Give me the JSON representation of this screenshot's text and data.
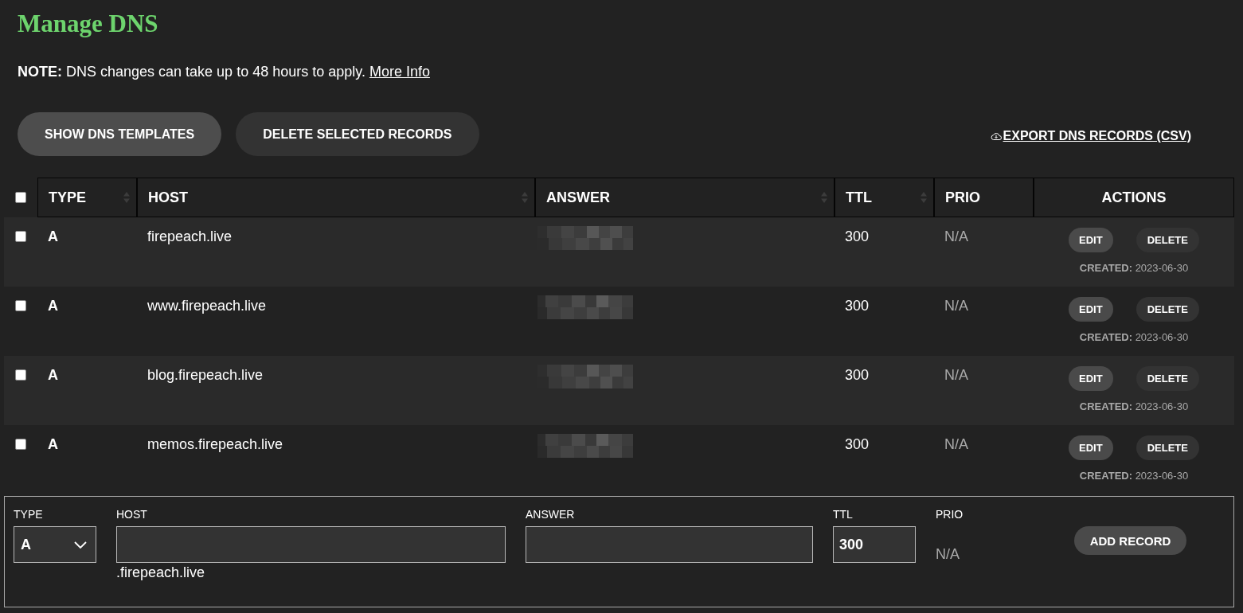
{
  "page": {
    "title": "Manage DNS"
  },
  "note": {
    "text": "**NOTE:** DNS changes can take up to 48 hours to apply.",
    "link": "More Info"
  },
  "toolbar": {
    "buttons": [
      {
        "label": "SHOW DNS TEMPLATES",
        "kind": "primary"
      },
      {
        "label": "DELETE SELECTED RECORDS",
        "kind": "secondary"
      }
    ],
    "export_link": "EXPORT DNS RECORDS (CSV)"
  },
  "table": {
    "select_all": {
      "checked": false
    },
    "columns": [
      {
        "label": "TYPE",
        "sortable": true
      },
      {
        "label": "HOST",
        "sortable": true
      },
      {
        "label": "ANSWER",
        "sortable": true
      },
      {
        "label": "TTL",
        "sortable": true
      },
      {
        "label": "PRIO",
        "sortable": false
      },
      {
        "label": "ACTIONS",
        "sortable": false
      }
    ],
    "rows": [
      {
        "checked": false,
        "type": "A",
        "host": "firepeach.live",
        "answer_redacted": true,
        "ttl": "300",
        "prio": "N/A",
        "actions": [
          {
            "label": "EDIT",
            "kind": "edit"
          },
          {
            "label": "DELETE",
            "kind": "delete"
          }
        ],
        "created": "**CREATED:** 2023-06-30"
      },
      {
        "checked": false,
        "type": "A",
        "host": "www.firepeach.live",
        "answer_redacted": true,
        "ttl": "300",
        "prio": "N/A",
        "actions": [
          {
            "label": "EDIT",
            "kind": "edit"
          },
          {
            "label": "DELETE",
            "kind": "delete"
          }
        ],
        "created": "**CREATED:** 2023-06-30"
      },
      {
        "checked": false,
        "type": "A",
        "host": "blog.firepeach.live",
        "answer_redacted": true,
        "ttl": "300",
        "prio": "N/A",
        "actions": [
          {
            "label": "EDIT",
            "kind": "edit"
          },
          {
            "label": "DELETE",
            "kind": "delete"
          }
        ],
        "created": "**CREATED:** 2023-06-30"
      },
      {
        "checked": false,
        "type": "A",
        "host": "memos.firepeach.live",
        "answer_redacted": true,
        "ttl": "300",
        "prio": "N/A",
        "actions": [
          {
            "label": "EDIT",
            "kind": "edit"
          },
          {
            "label": "DELETE",
            "kind": "delete"
          }
        ],
        "created": "**CREATED:** 2023-06-30"
      }
    ]
  },
  "add_form": {
    "fields": [
      {
        "kind": "select",
        "label": "TYPE",
        "value": "A"
      },
      {
        "kind": "text",
        "label": "HOST",
        "suffix": ".firepeach.live"
      },
      {
        "kind": "text",
        "label": "ANSWER"
      },
      {
        "kind": "text",
        "label": "TTL",
        "value": "300"
      },
      {
        "kind": "static",
        "label": "PRIO",
        "value": "N/A"
      }
    ],
    "button": "ADD RECORD"
  }
}
